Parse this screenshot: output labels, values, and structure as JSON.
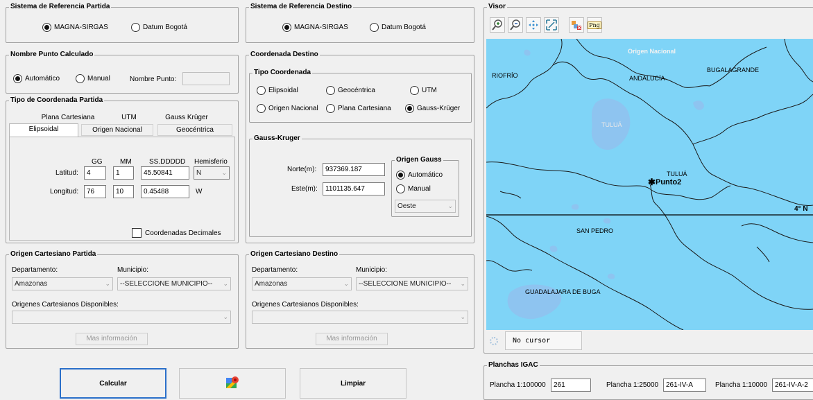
{
  "ref_partida": {
    "title": "Sistema de Referencia Partida",
    "options": [
      "MAGNA-SIRGAS",
      "Datum Bogotá"
    ]
  },
  "ref_destino": {
    "title": "Sistema de Referencia Destino",
    "options": [
      "MAGNA-SIRGAS",
      "Datum Bogotá"
    ]
  },
  "nombre_punto": {
    "title": "Nombre Punto Calculado",
    "automatico": "Automático",
    "manual": "Manual",
    "nombre_label": "Nombre Punto:",
    "nombre_value": ""
  },
  "tipo_partida": {
    "title": "Tipo de Coordenada Partida",
    "tabs_row1": [
      "Plana Cartesiana",
      "UTM",
      "Gauss Krüger"
    ],
    "tabs_row2": [
      "Elipsoidal",
      "Origen Nacional",
      "Geocéntrica"
    ],
    "headers": [
      "GG",
      "MM",
      "SS.DDDDD",
      "Hemisferio"
    ],
    "latitud_label": "Latitud:",
    "latitud": [
      "4",
      "1",
      "45.50841"
    ],
    "lat_hemisferio": "N",
    "longitud_label": "Longitud:",
    "longitud": [
      "76",
      "10",
      "0.45488"
    ],
    "lon_hemisferio": "W",
    "decimales_label": "Coordenadas Decimales"
  },
  "coord_destino": {
    "title": "Coordenada Destino",
    "tipo_title": "Tipo Coordenada",
    "tipos": [
      "Elipsoidal",
      "Geocéntrica",
      "UTM",
      "Origen Nacional",
      "Plana Cartesiana",
      "Gauss-Krüger"
    ],
    "gauss_title": "Gauss-Kruger",
    "norte_label": "Norte(m):",
    "norte": "937369.187",
    "este_label": "Este(m):",
    "este": "1101135.647",
    "origen_title": "Origen Gauss",
    "origen_auto": "Automático",
    "origen_manual": "Manual",
    "origen_select": "Oeste"
  },
  "cart_partida": {
    "title": "Origen Cartesiano Partida",
    "departamento_label": "Departamento:",
    "municipio_label": "Municipio:",
    "departamento": "Amazonas",
    "municipio": "--SELECCIONE MUNICIPIO--",
    "origenes_label": "Origenes Cartesianos Disponibles:",
    "origenes_value": "",
    "info_button": "Mas información"
  },
  "cart_destino": {
    "title": "Origen Cartesiano Destino",
    "departamento_label": "Departamento:",
    "municipio_label": "Municipio:",
    "departamento": "Amazonas",
    "municipio": "--SELECCIONE MUNICIPIO--",
    "origenes_label": "Origenes Cartesianos Disponibles:",
    "origenes_value": "",
    "info_button": "Mas información"
  },
  "actions": {
    "calcular": "Calcular",
    "limpiar": "Limpiar"
  },
  "visor": {
    "title": "Visor",
    "tools": [
      "zoom-in-icon",
      "zoom-out-icon",
      "pan-icon",
      "zoom-extent-icon",
      "clear-icon",
      "export-png-icon"
    ],
    "png_label": "Png",
    "map_labels": {
      "origen_nacional": "Origen Nacional",
      "riofrio": "RIOFRÍO",
      "andalucia": "ANDALUCÍA",
      "bugalagrande": "BUGALAGRANDE",
      "tulua_water": "TULUÁ",
      "tulua": "TULUÁ",
      "punto": "Punto2",
      "lat_label": "4° N",
      "san_pedro": "SAN PEDRO",
      "guadalajara": "GUADALAJARA DE BUGA"
    },
    "cursor_text": "No cursor",
    "colors": {
      "water": "#7fd4f7",
      "lake": "#8ec4f0",
      "background": "#f0f0f0"
    }
  },
  "planchas": {
    "title": "Planchas IGAC",
    "p100k_label": "Plancha 1:100000",
    "p100k": "261",
    "p25k_label": "Plancha 1:25000",
    "p25k": "261-IV-A",
    "p10k_label": "Plancha 1:10000",
    "p10k": "261-IV-A-2"
  }
}
